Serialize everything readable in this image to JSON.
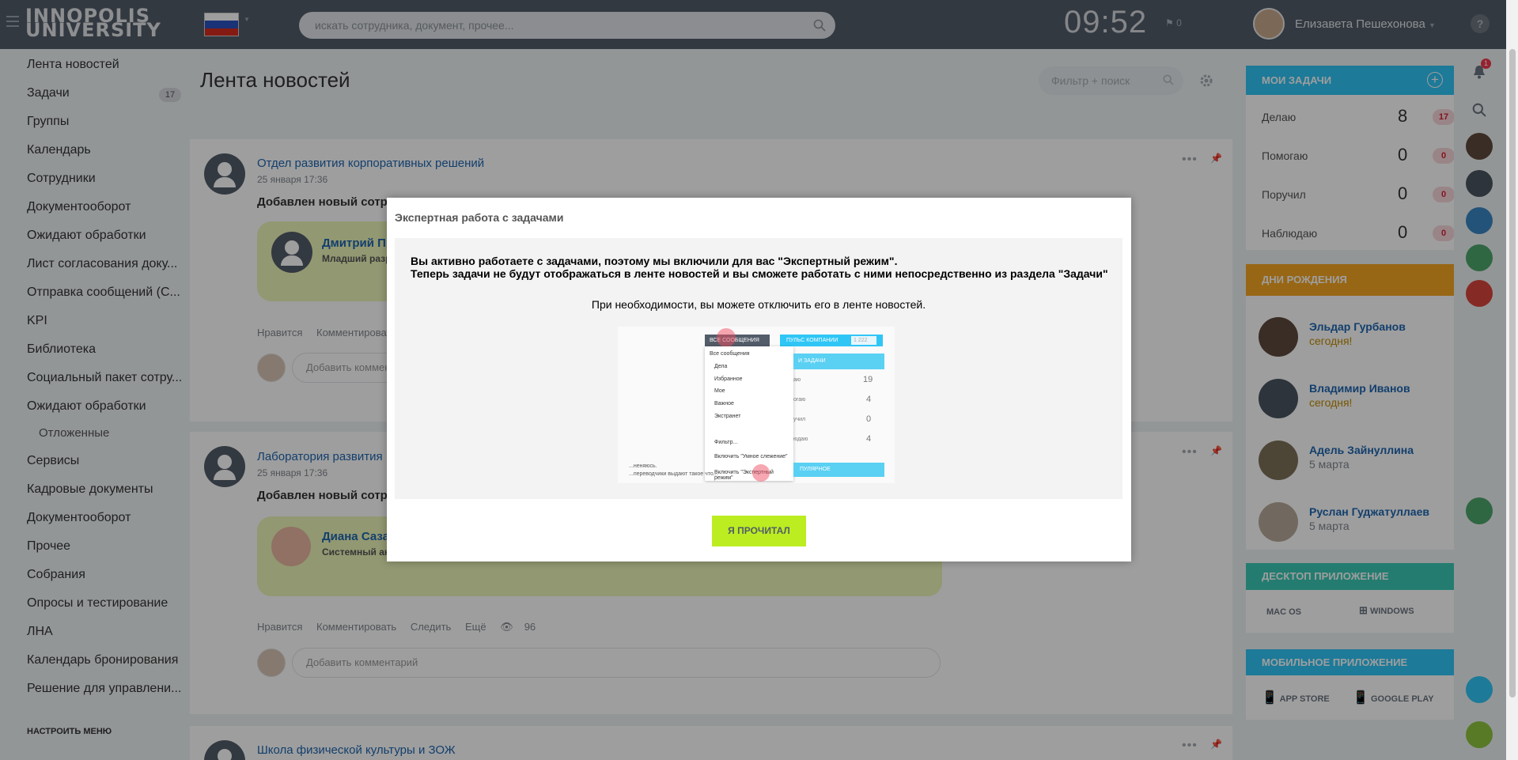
{
  "header": {
    "logo_line1": "INNOPOLIS",
    "logo_line2": "UNIVERSITY",
    "search_placeholder": "искать сотрудника, документ, прочее...",
    "clock": "09:52",
    "flag_count": "0",
    "user_name": "Елизавета Пешехонова",
    "help": "?"
  },
  "sidebar": {
    "items": [
      {
        "label": "Лента новостей"
      },
      {
        "label": "Задачи",
        "badge": "17"
      },
      {
        "label": "Группы"
      },
      {
        "label": "Календарь"
      },
      {
        "label": "Сотрудники"
      },
      {
        "label": "Документооборот"
      },
      {
        "label": "Ожидают обработки"
      },
      {
        "label": "Лист согласования доку..."
      },
      {
        "label": "Отправка сообщений (С..."
      },
      {
        "label": "KPI"
      },
      {
        "label": "Библиотека"
      },
      {
        "label": "Социальный пакет сотру..."
      },
      {
        "label": "Ожидают обработки"
      },
      {
        "label": "Отложенные"
      },
      {
        "label": "Сервисы"
      },
      {
        "label": "Кадровые документы"
      },
      {
        "label": "Документооборот"
      },
      {
        "label": "Прочее"
      },
      {
        "label": "Собрания"
      },
      {
        "label": "Опросы и тестирование"
      },
      {
        "label": "ЛНА"
      },
      {
        "label": "Календарь бронирования"
      },
      {
        "label": "Решение для управлени..."
      }
    ],
    "configure": "НАСТРОИТЬ МЕНЮ"
  },
  "main": {
    "title": "Лента новостей",
    "filter_placeholder": "Фильтр + поиск",
    "posts": [
      {
        "author": "Отдел развития корпоративных решений",
        "date": "25 января 17:36",
        "text": "Добавлен новый сотруд",
        "card_name": "Дмитрий Пр",
        "card_role": "Младший разр",
        "actions": [
          "Нравится",
          "Комментироват"
        ],
        "comment_placeholder": "Добавить коммент"
      },
      {
        "author": "Лаборатория развития",
        "date": "25 января 17:36",
        "text": "Добавлен новый сотруд",
        "card_name": "Диана Сазан",
        "card_role": "Системный ан",
        "actions": [
          "Нравится",
          "Комментировать",
          "Следить",
          "Ещё"
        ],
        "views": "96",
        "comment_placeholder": "Добавить комментарий"
      },
      {
        "author": "Школа физической культуры и ЗОЖ"
      }
    ]
  },
  "right_panel": {
    "tasks": {
      "title": "МОИ ЗАДАЧИ",
      "rows": [
        {
          "label": "Делаю",
          "count": "8",
          "badge": "17"
        },
        {
          "label": "Помогаю",
          "count": "0",
          "badge": "0"
        },
        {
          "label": "Поручил",
          "count": "0",
          "badge": "0"
        },
        {
          "label": "Наблюдаю",
          "count": "0",
          "badge": "0"
        }
      ]
    },
    "birthdays": {
      "title": "ДНИ РОЖДЕНИЯ",
      "people": [
        {
          "name": "Эльдар Гурбанов",
          "date": "сегодня!"
        },
        {
          "name": "Владимир Иванов",
          "date": "сегодня!"
        },
        {
          "name": "Адель Зайнуллина",
          "date": "5 марта"
        },
        {
          "name": "Руслан Гуджатуллаев",
          "date": "5 марта"
        }
      ]
    },
    "desktop": {
      "title": "ДЕСКТОП ПРИЛОЖЕНИЕ",
      "mac": "MAC OS",
      "windows": "WINDOWS"
    },
    "mobile": {
      "title": "МОБИЛЬНОЕ ПРИЛОЖЕНИЕ",
      "appstore": "APP STORE",
      "googleplay": "GOOGLE PLAY"
    }
  },
  "rightbar": {
    "notif_count": "1"
  },
  "modal": {
    "title": "Экспертная работа с задачами",
    "line1": "Вы активно работаете с задачами, поэтому мы включили для вас \"Экспертный режим\".",
    "line2": "Теперь задачи не будут отображаться в ленте новостей и вы сможете работать с ними непосредственно из раздела \"Задачи\"",
    "line3": "При необходимости, вы можете отключить его в ленте новостей.",
    "shot": {
      "menu_title": "ВСЕ СООБЩЕНИЯ",
      "pulse": "ПУЛЬС КОМПАНИИ",
      "pulse_num": "1 222",
      "items": [
        "Все сообщения",
        "Дела",
        "Избранное",
        "Мое",
        "Важное",
        "Экстранет",
        "Фильтр...",
        "Включить \"Умное слежение\"",
        "Включить \"Экспертный режим\""
      ],
      "tasks_title": "И ЗАДАЧИ",
      "task_nums": [
        "19",
        "4",
        "0",
        "4"
      ],
      "task_labels": [
        "аю",
        "огаю",
        "учил",
        "юдаю"
      ],
      "popular": "ПУЛЯРНОЕ",
      "snip1": "...неняюсь.",
      "snip2": "...переводчики выдают такое что..."
    },
    "button": "Я ПРОЧИТАЛ"
  }
}
